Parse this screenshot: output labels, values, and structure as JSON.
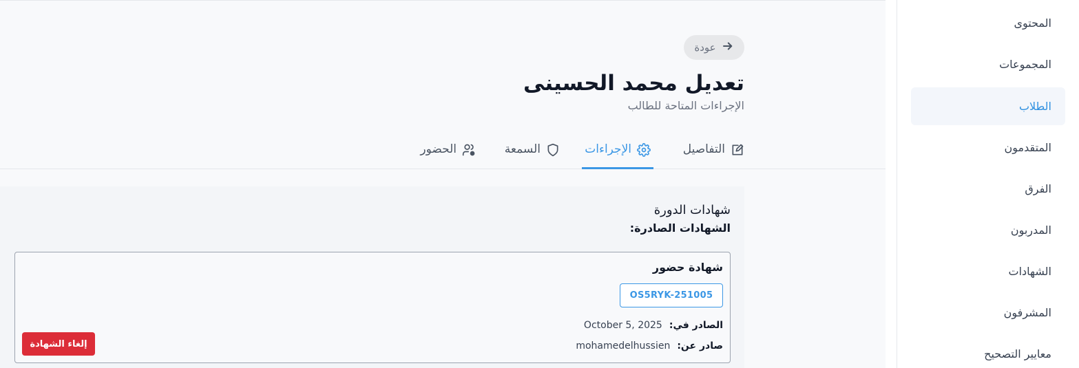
{
  "sidebar": {
    "items": [
      {
        "label": "المحتوى",
        "active": false
      },
      {
        "label": "المجموعات",
        "active": false
      },
      {
        "label": "الطلاب",
        "active": true
      },
      {
        "label": "المتقدمون",
        "active": false
      },
      {
        "label": "الفرق",
        "active": false
      },
      {
        "label": "المدربون",
        "active": false
      },
      {
        "label": "الشهادات",
        "active": false
      },
      {
        "label": "المشرفون",
        "active": false
      },
      {
        "label": "معايير التصحيح",
        "active": false
      }
    ]
  },
  "header": {
    "back_label": "عودة",
    "title": "تعديل محمد الحسينى",
    "subtitle": "الإجراءات المتاحة للطالب"
  },
  "tabs": [
    {
      "label": "التفاصيل",
      "icon": "edit-icon",
      "active": false
    },
    {
      "label": "الإجراءات",
      "icon": "gear-icon",
      "active": true
    },
    {
      "label": "السمعة",
      "icon": "shield-icon",
      "active": false
    },
    {
      "label": "الحضور",
      "icon": "user-check-icon",
      "active": false
    }
  ],
  "certificates": {
    "section_title": "شهادات الدورة",
    "issued_heading": "الشهادات الصادرة:",
    "items": [
      {
        "name": "شهادة حضور",
        "code": "OS5RYK-251005",
        "issued_on_label": "الصادر في:",
        "issued_on": "October 5, 2025",
        "issued_by_label": "صادر عن:",
        "issued_by": "mohamedelhussien",
        "revoke_label": "إلغاء الشهادة"
      }
    ]
  },
  "colors": {
    "accent": "#3b97e5",
    "danger": "#dc2d38",
    "sidebar_active_bg": "#f3f6fb"
  }
}
